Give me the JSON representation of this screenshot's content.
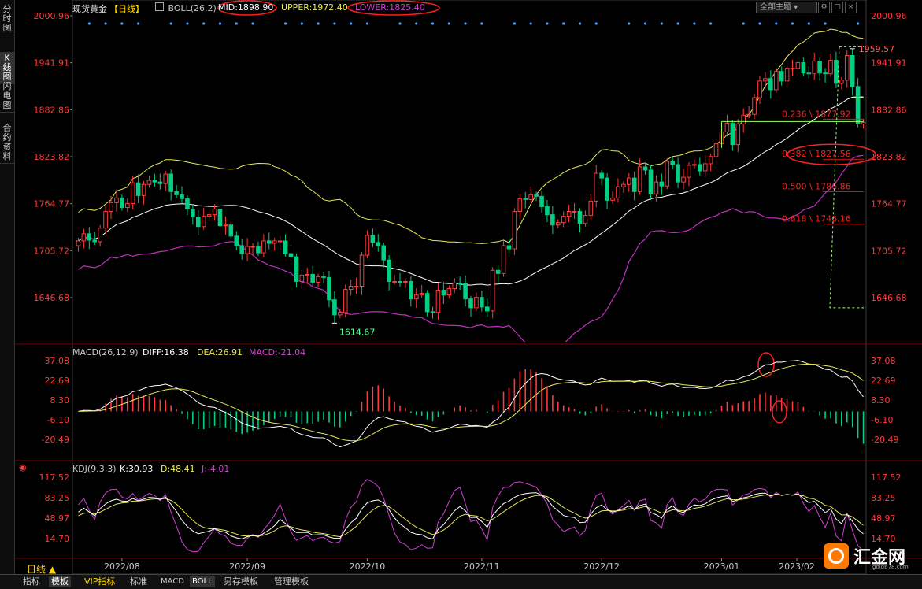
{
  "sidebar": {
    "tabs": [
      "分时图",
      "K线图",
      "闪电图",
      "合约资料"
    ]
  },
  "header": {
    "title": "现货黄金",
    "period": "【日线】",
    "boll_label": "BOLL(26,2)",
    "mid": "MID:1898.90",
    "upper": "UPPER:1972.40",
    "lower": "LOWER:1825.40",
    "theme_button": "全部主题"
  },
  "price_axis": {
    "ticks": [
      "2000.96",
      "1941.91",
      "1882.86",
      "1823.82",
      "1764.77",
      "1705.72",
      "1646.68"
    ]
  },
  "annotations": {
    "high": "1959.57",
    "low": "1614.67",
    "fib": [
      {
        "label": "0.236 \\ 1877.92",
        "price": 1877.92
      },
      {
        "label": "0.382 \\ 1827.56",
        "price": 1827.56
      },
      {
        "label": "0.500 \\ 1786.86",
        "price": 1786.86
      },
      {
        "label": "0.618 \\ 1746.16",
        "price": 1746.16
      }
    ]
  },
  "macd": {
    "label": "MACD(26,12,9)",
    "diff": "DIFF:16.38",
    "dea": "DEA:26.91",
    "macd": "MACD:-21.04",
    "ticks": [
      "37.08",
      "22.69",
      "8.30",
      "-6.10",
      "-20.49"
    ]
  },
  "kdj": {
    "label": "KDJ(9,3,3)",
    "k": "K:30.93",
    "d": "D:48.41",
    "j": "J:-4.01",
    "ticks": [
      "117.52",
      "83.25",
      "48.97",
      "14.70"
    ]
  },
  "time_axis": {
    "period_button": "日线 ▲",
    "months": [
      "2022/08",
      "2022/09",
      "2022/10",
      "2022/11",
      "2022/12",
      "2023/01",
      "2023/02"
    ]
  },
  "bottom_tabs": [
    "指标",
    "模板",
    "VIP指标",
    "标准",
    "MACD",
    "BOLL",
    "另存模板",
    "管理模板"
  ],
  "brand": {
    "name": "汇金网",
    "url": "gold678.com"
  },
  "colors": {
    "up": "#ff3b3b",
    "down": "#00d084",
    "mid": "#ffffff",
    "upper": "#e8e85a",
    "lower": "#c030c0",
    "accent_red": "#ff2020",
    "fib_green": "#9cff60"
  },
  "chart_data": {
    "type": "candlestick",
    "title": "现货黄金 日线",
    "x": [
      "2022/07/21",
      "2022/07/22",
      "2022/07/25",
      "2022/07/26",
      "2022/07/27",
      "2022/07/28",
      "2022/07/29",
      "2022/08/01",
      "2022/08/02",
      "2022/08/03",
      "2022/08/04",
      "2022/08/05",
      "2022/08/08",
      "2022/08/09",
      "2022/08/10",
      "2022/08/11",
      "2022/08/12",
      "2022/08/15",
      "2022/08/16",
      "2022/08/17",
      "2022/08/18",
      "2022/08/19",
      "2022/08/22",
      "2022/08/23",
      "2022/08/24",
      "2022/08/25",
      "2022/08/26",
      "2022/08/29",
      "2022/08/30",
      "2022/08/31",
      "2022/09/01",
      "2022/09/02",
      "2022/09/05",
      "2022/09/06",
      "2022/09/07",
      "2022/09/08",
      "2022/09/09",
      "2022/09/12",
      "2022/09/13",
      "2022/09/14",
      "2022/09/15",
      "2022/09/16",
      "2022/09/19",
      "2022/09/20",
      "2022/09/21",
      "2022/09/22",
      "2022/09/23",
      "2022/09/26",
      "2022/09/27",
      "2022/09/28",
      "2022/09/29",
      "2022/09/30",
      "2022/10/03",
      "2022/10/04",
      "2022/10/05",
      "2022/10/06",
      "2022/10/07",
      "2022/10/10",
      "2022/10/11",
      "2022/10/12",
      "2022/10/13",
      "2022/10/14",
      "2022/10/17",
      "2022/10/18",
      "2022/10/19",
      "2022/10/20",
      "2022/10/21",
      "2022/10/24",
      "2022/10/25",
      "2022/10/26",
      "2022/10/27",
      "2022/10/28",
      "2022/10/31",
      "2022/11/01",
      "2022/11/02",
      "2022/11/03",
      "2022/11/04",
      "2022/11/07",
      "2022/11/08",
      "2022/11/09",
      "2022/11/10",
      "2022/11/11",
      "2022/11/14",
      "2022/11/15",
      "2022/11/16",
      "2022/11/17",
      "2022/11/18",
      "2022/11/21",
      "2022/11/22",
      "2022/11/23",
      "2022/11/24",
      "2022/11/25",
      "2022/11/28",
      "2022/11/29",
      "2022/11/30",
      "2022/12/01",
      "2022/12/02",
      "2022/12/05",
      "2022/12/06",
      "2022/12/07",
      "2022/12/08",
      "2022/12/09",
      "2022/12/12",
      "2022/12/13",
      "2022/12/14",
      "2022/12/15",
      "2022/12/16",
      "2022/12/19",
      "2022/12/20",
      "2022/12/21",
      "2022/12/22",
      "2022/12/23",
      "2022/12/26",
      "2022/12/27",
      "2022/12/28",
      "2022/12/29",
      "2022/12/30",
      "2023/01/02",
      "2023/01/03",
      "2023/01/04",
      "2023/01/05",
      "2023/01/06",
      "2023/01/09",
      "2023/01/10",
      "2023/01/11",
      "2023/01/12",
      "2023/01/13",
      "2023/01/16",
      "2023/01/17",
      "2023/01/18",
      "2023/01/19",
      "2023/01/20",
      "2023/01/23",
      "2023/01/24",
      "2023/01/25",
      "2023/01/26",
      "2023/01/27",
      "2023/01/30",
      "2023/01/31",
      "2023/02/01",
      "2023/02/02",
      "2023/02/03",
      "2023/02/06"
    ],
    "close": [
      1718,
      1727,
      1719,
      1717,
      1734,
      1755,
      1766,
      1772,
      1760,
      1765,
      1791,
      1775,
      1789,
      1794,
      1792,
      1790,
      1802,
      1780,
      1776,
      1771,
      1758,
      1748,
      1736,
      1749,
      1751,
      1758,
      1737,
      1738,
      1724,
      1712,
      1702,
      1711,
      1711,
      1703,
      1718,
      1715,
      1718,
      1718,
      1702,
      1698,
      1667,
      1675,
      1676,
      1666,
      1673,
      1672,
      1644,
      1625,
      1628,
      1657,
      1661,
      1661,
      1700,
      1725,
      1716,
      1712,
      1694,
      1667,
      1667,
      1666,
      1667,
      1645,
      1650,
      1652,
      1629,
      1628,
      1656,
      1650,
      1658,
      1665,
      1664,
      1645,
      1634,
      1647,
      1635,
      1630,
      1681,
      1677,
      1712,
      1708,
      1755,
      1771,
      1770,
      1776,
      1774,
      1761,
      1751,
      1738,
      1741,
      1749,
      1755,
      1755,
      1740,
      1750,
      1768,
      1803,
      1797,
      1769,
      1772,
      1786,
      1789,
      1797,
      1780,
      1811,
      1807,
      1777,
      1792,
      1787,
      1818,
      1814,
      1792,
      1798,
      1813,
      1814,
      1806,
      1815,
      1824,
      1840,
      1855,
      1866,
      1839,
      1865,
      1876,
      1877,
      1898,
      1919,
      1922,
      1908,
      1931,
      1919,
      1935,
      1935,
      1942,
      1929,
      1928,
      1944,
      1929,
      1928,
      1945,
      1916,
      1920,
      1951,
      1912,
      1865,
      1867
    ],
    "bands": {
      "mid_last": 1898.9,
      "upper_last": 1972.4,
      "lower_last": 1825.4
    },
    "fib_levels": [
      1877.92,
      1827.56,
      1786.86,
      1746.16
    ],
    "high": 1959.57,
    "low": 1614.67,
    "ylim": [
      1620,
      2000.96
    ],
    "ylabel_ticks": [
      2000.96,
      1941.91,
      1882.86,
      1823.82,
      1764.77,
      1705.72,
      1646.68
    ],
    "macd_ylim": [
      -28,
      42
    ],
    "kdj_ylim": [
      -8,
      120
    ]
  }
}
